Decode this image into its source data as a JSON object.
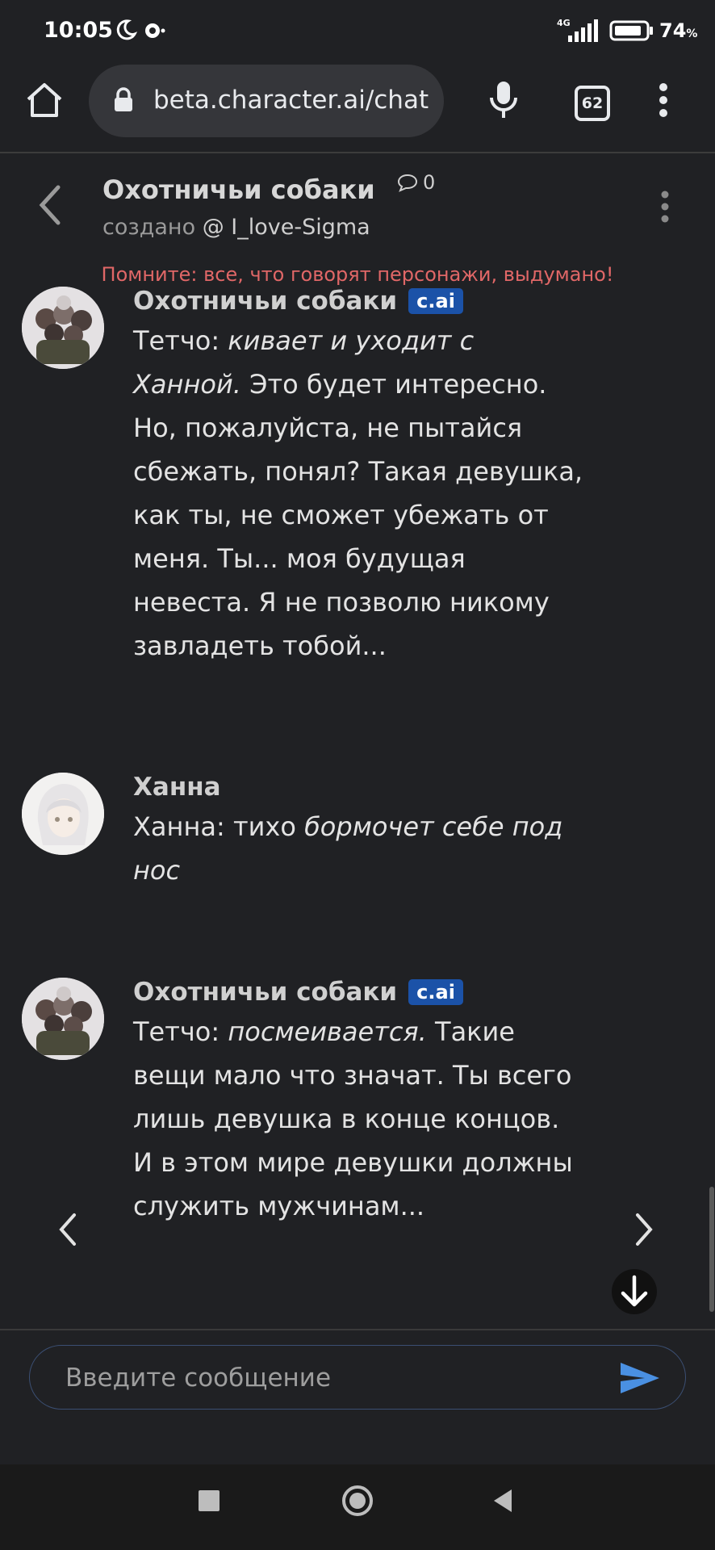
{
  "status_bar": {
    "time": "10:05",
    "network": "4G",
    "battery": "74",
    "battery_unit": "%"
  },
  "browser": {
    "url": "beta.character.ai/chat",
    "tab_count": "62"
  },
  "chat": {
    "title": "Охотничьи собаки",
    "comment_count": "0",
    "created_prefix": "создано",
    "creator": "@ I_love-Sigma",
    "warning": "Помните: все, что говорят персонажи, выдумано!"
  },
  "messages": [
    {
      "author": "Охотничьи собаки",
      "badge": "c.ai",
      "speaker": "Тетчо: ",
      "action": "кивает и уходит с Ханной.",
      "text": " Это будет интересно. Но, пожалуйста, не пытайся сбежать, понял? Такая девушка, как ты, не сможет убежать от меня. Ты... моя будущая невеста. Я не позволю никому завладеть тобой..."
    },
    {
      "author": "Ханна",
      "badge": "",
      "speaker": "Ханна: тихо ",
      "action": "бормочет себе под нос",
      "text": ""
    },
    {
      "author": "Охотничьи собаки",
      "badge": "c.ai",
      "speaker": "Тетчо: ",
      "action": "посмеивается.",
      "text": " Такие вещи мало что значат. Ты всего лишь девушка в конце концов. И в этом мире девушки должны служить мужчинам..."
    }
  ],
  "input": {
    "placeholder": "Введите сообщение"
  },
  "colors": {
    "background": "#202124",
    "warning": "#e06767",
    "badge": "#1b52a8",
    "send": "#4a90e2"
  },
  "icons": [
    "home-icon",
    "lock-icon",
    "mic-icon",
    "more-vert-icon",
    "back-arrow-icon",
    "comment-icon",
    "chevron-left-icon",
    "chevron-right-icon",
    "arrow-down-icon",
    "send-icon",
    "recents-icon",
    "home-circle-icon",
    "nav-back-icon"
  ]
}
